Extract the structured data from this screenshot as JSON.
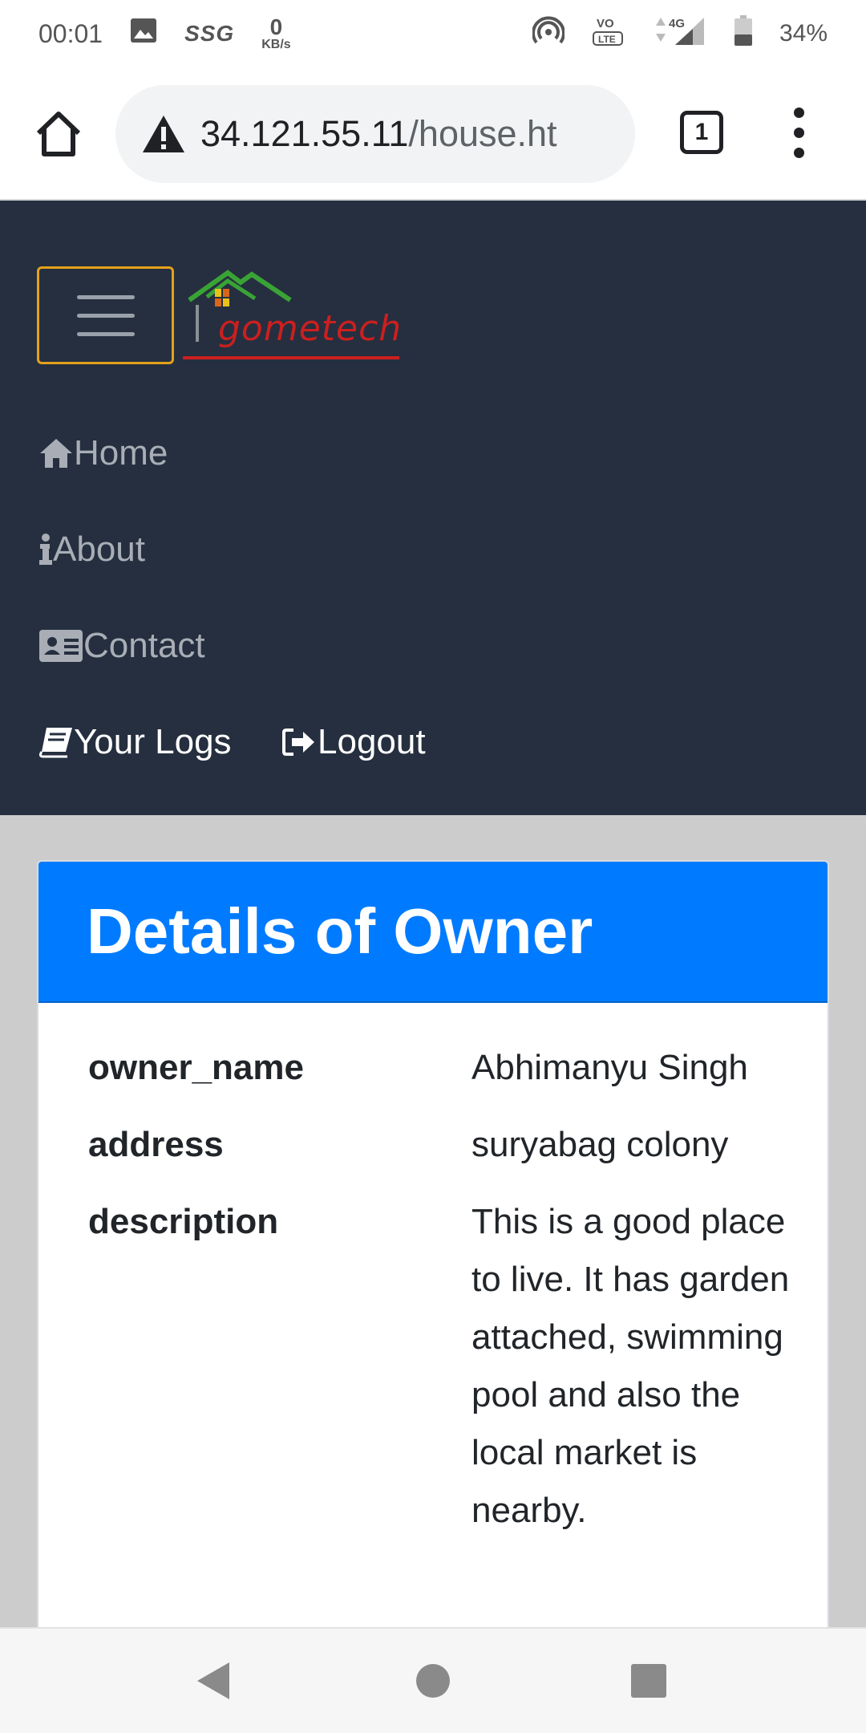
{
  "status_bar": {
    "time": "00:01",
    "network_label": "SSG",
    "data_rate_value": "0",
    "data_rate_unit": "KB/s",
    "network_type": "4G",
    "battery_percent": "34%"
  },
  "browser": {
    "url_host": "34.121.55.11",
    "url_path": "/house.ht",
    "tab_count": "1"
  },
  "site": {
    "brand_text": "gometech",
    "nav": {
      "home": "Home",
      "about": "About",
      "contact": "Contact",
      "your_logs": "Your Logs",
      "logout": "Logout"
    }
  },
  "card": {
    "title": "Details of Owner",
    "rows": [
      {
        "key": "owner_name",
        "value": "Abhimanyu Singh"
      },
      {
        "key": "address",
        "value": "suryabag colony"
      },
      {
        "key": "description",
        "value": "This is a good place to live. It has garden attached, swimming pool and also the local market is nearby."
      }
    ]
  },
  "colors": {
    "navbar_bg": "#252f3f",
    "card_header_bg": "#007bff",
    "toggler_border": "#e5a11a",
    "brand_red": "#cc1f1f",
    "brand_green": "#3aa335"
  }
}
